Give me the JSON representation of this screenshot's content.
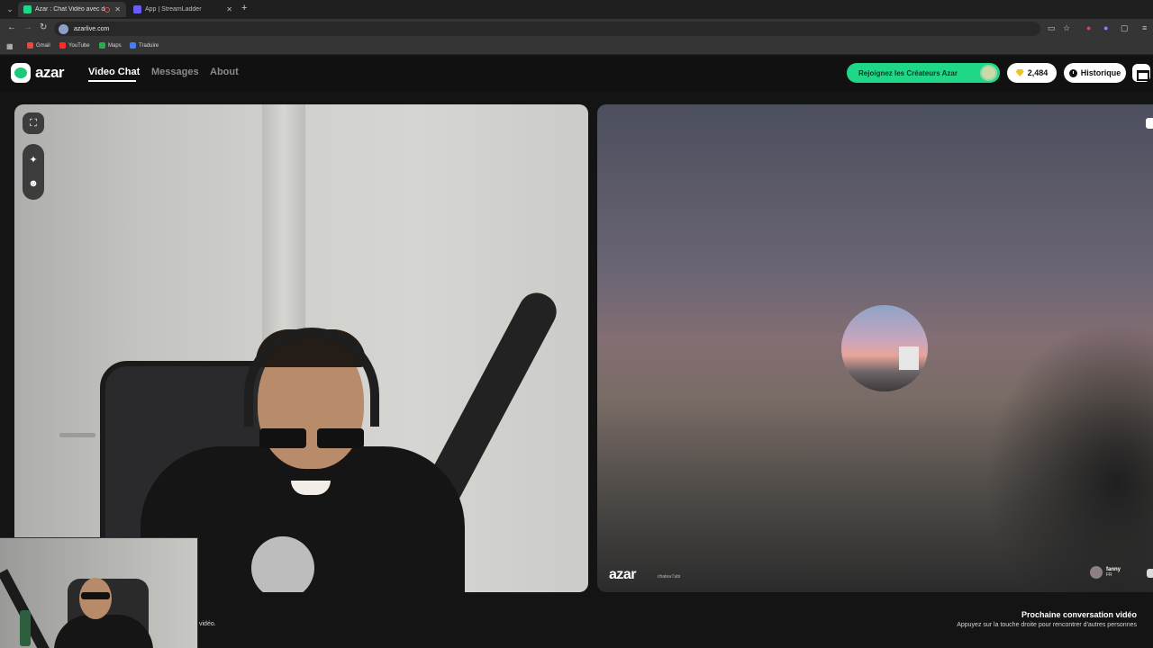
{
  "browser": {
    "tabs": [
      {
        "title": "Azar : Chat Vidéo avec de",
        "active": true,
        "favicon_color": "#20d788"
      },
      {
        "title": "App | StreamLadder",
        "active": false,
        "favicon_color": "#6b5cff"
      }
    ],
    "url": "azarlive.com",
    "bookmarks": [
      {
        "label": "Gmail",
        "color": "#e64a3c"
      },
      {
        "label": "YouTube",
        "color": "#ff2a2a"
      },
      {
        "label": "Maps",
        "color": "#2fa84f"
      },
      {
        "label": "Traduire",
        "color": "#4a7cf0"
      }
    ]
  },
  "header": {
    "logo_text": "azar",
    "nav": [
      "Video Chat",
      "Messages",
      "About"
    ],
    "creators_label": "Rejoignez les Créateurs Azar",
    "gems_count": "2,484",
    "history_label": "Historique",
    "accent_color": "#20d788"
  },
  "partner": {
    "watermark": "azar",
    "watermark_sub": "chatea l'ubi",
    "name": "fanny",
    "country": "FR"
  },
  "footer": {
    "next_title": "Prochaine conversation vidéo",
    "next_subtitle": "Appuyez sur la touche droite pour rencontrer d'autres personnes",
    "left_snippet": "vidéo."
  }
}
